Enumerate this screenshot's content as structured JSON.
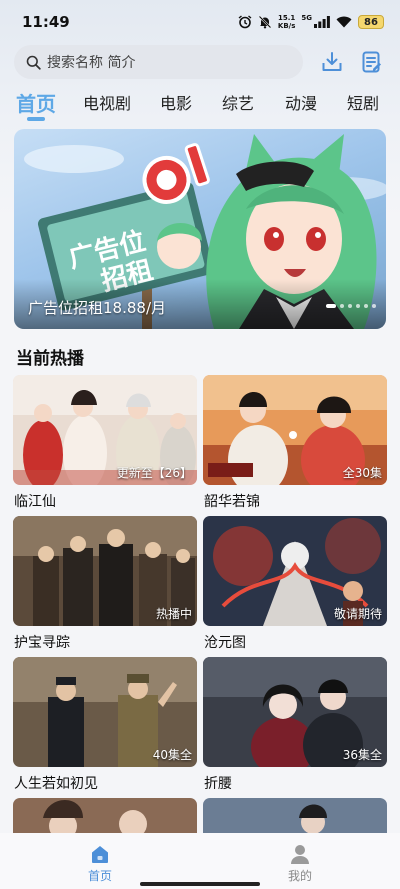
{
  "status_bar": {
    "time": "11:49",
    "net_speed_value": "15.1",
    "net_speed_unit": "KB/s",
    "signal_label": "5G",
    "battery": "86"
  },
  "search": {
    "placeholder": "搜索名称 简介"
  },
  "tabs": [
    {
      "label": "首页",
      "active": true
    },
    {
      "label": "电视剧",
      "active": false
    },
    {
      "label": "电影",
      "active": false
    },
    {
      "label": "综艺",
      "active": false
    },
    {
      "label": "动漫",
      "active": false
    },
    {
      "label": "短剧",
      "active": false
    }
  ],
  "banner": {
    "sign_text_line1": "广告位",
    "sign_text_line2": "招租",
    "caption": "广告位招租18.88/月"
  },
  "section": {
    "title": "当前热播"
  },
  "shows": [
    {
      "title": "临江仙",
      "badge": "更新至【26】"
    },
    {
      "title": "韶华若锦",
      "badge": "全30集"
    },
    {
      "title": "护宝寻踪",
      "badge": "热播中"
    },
    {
      "title": "沧元图",
      "badge": "敬请期待"
    },
    {
      "title": "人生若如初见",
      "badge": "40集全"
    },
    {
      "title": "折腰",
      "badge": "36集全"
    }
  ],
  "bottom_nav": [
    {
      "label": "首页",
      "active": true
    },
    {
      "label": "我的",
      "active": false
    }
  ],
  "colors": {
    "accent": "#5ea8e6",
    "nav_active": "#4d8fd8"
  }
}
